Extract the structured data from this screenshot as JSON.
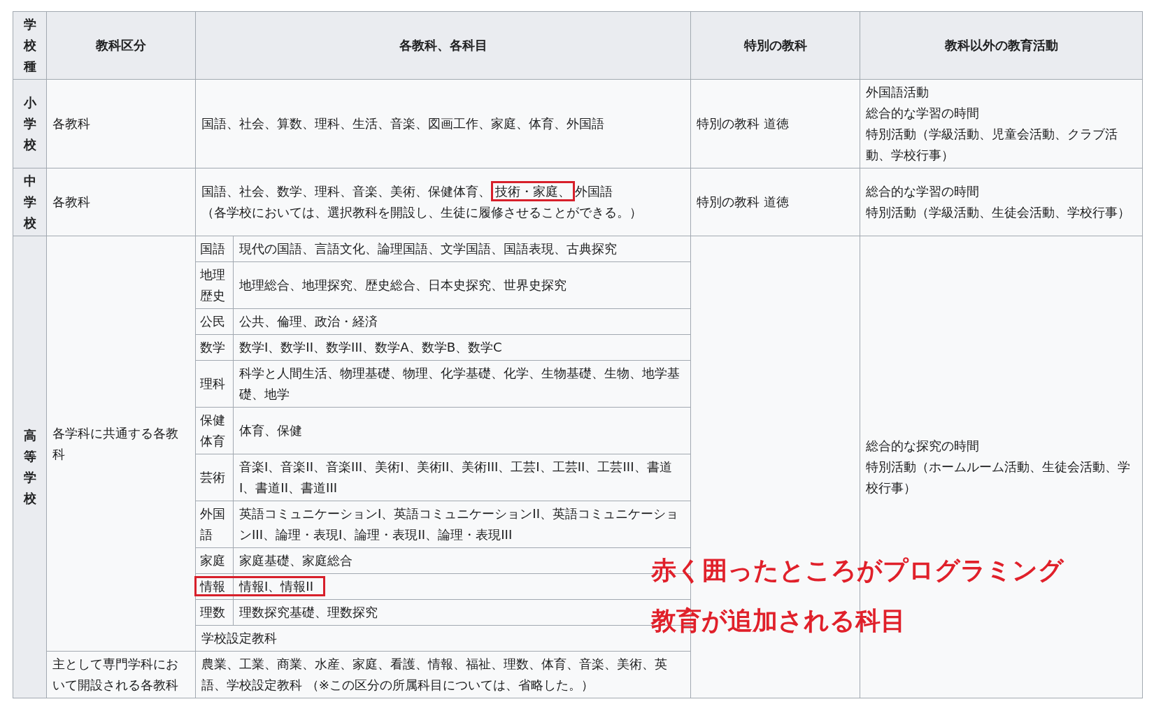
{
  "columns": [
    "学校種",
    "教科区分",
    "各教科、各科目",
    "特別の教科",
    "教科以外の教育活動"
  ],
  "rows": [
    {
      "school": "小学校",
      "category": "各教科",
      "subjects": [
        {
          "text": "国語、社会、算数、理科、生活、音楽、図画工作、家庭、体育、外国語",
          "highlighted": false
        }
      ],
      "special": "特別の教科 道徳",
      "activities": [
        "外国語活動",
        "総合的な学習の時間",
        "特別活動（学級活動、児童会活動、クラブ活動、学校行事）"
      ]
    },
    {
      "school": "中学校",
      "category": "各教科",
      "subjects": [
        {
          "text": "国語、社会、数学、理科、音楽、美術、保健体育、",
          "highlighted": false
        },
        {
          "text": "技術・家庭、",
          "highlighted": true
        },
        {
          "text": "外国語",
          "highlighted": false
        }
      ],
      "note": "（各学校においては、選択教科を開設し、生徒に履修させることができる。）",
      "special": "特別の教科 道徳",
      "activities": [
        "総合的な学習の時間",
        "特別活動（学級活動、生徒会活動、学校行事）"
      ]
    }
  ],
  "high_school": {
    "school": "高等学校",
    "activities": [
      "総合的な探究の時間",
      "特別活動（ホームルーム活動、生徒会活動、学校行事）"
    ],
    "common": {
      "category": "各学科に共通する各教科",
      "subjects": [
        {
          "area": "国語",
          "courses": "現代の国語、言語文化、論理国語、文学国語、国語表現、古典探究",
          "highlighted": false
        },
        {
          "area": "地理歴史",
          "courses": "地理総合、地理探究、歴史総合、日本史探究、世界史探究",
          "highlighted": false
        },
        {
          "area": "公民",
          "courses": "公共、倫理、政治・経済",
          "highlighted": false
        },
        {
          "area": "数学",
          "courses": "数学I、数学II、数学III、数学A、数学B、数学C",
          "highlighted": false
        },
        {
          "area": "理科",
          "courses": "科学と人間生活、物理基礎、物理、化学基礎、化学、生物基礎、生物、地学基礎、地学",
          "highlighted": false
        },
        {
          "area": "保健体育",
          "courses": "体育、保健",
          "highlighted": false
        },
        {
          "area": "芸術",
          "courses": "音楽I、音楽II、音楽III、美術I、美術II、美術III、工芸I、工芸II、工芸III、書道I、書道II、書道III",
          "highlighted": false
        },
        {
          "area": "外国語",
          "courses": "英語コミュニケーションI、英語コミュニケーションII、英語コミュニケーションIII、論理・表現I、論理・表現II、論理・表現III",
          "highlighted": false
        },
        {
          "area": "家庭",
          "courses": "家庭基礎、家庭総合",
          "highlighted": false
        },
        {
          "area": "情報",
          "courses": "情報I、情報II",
          "highlighted": true
        },
        {
          "area": "理数",
          "courses": "理数探究基礎、理数探究",
          "highlighted": false
        }
      ],
      "extra": "学校設定教科"
    },
    "specialized": {
      "category": "主として専門学科において開設される各教科",
      "courses": "農業、工業、商業、水産、家庭、看護、情報、福祉、理数、体育、音楽、美術、英語、学校設定教科 （※この区分の所属科目については、省略した。）"
    }
  },
  "annotation": [
    "赤く囲ったところがプログラミング",
    "教育が追加される科目"
  ]
}
